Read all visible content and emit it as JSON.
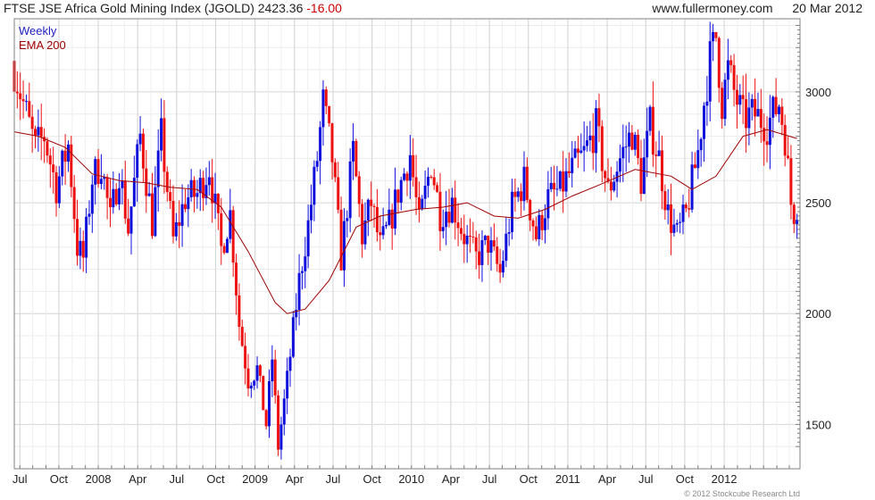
{
  "header": {
    "title": "FTSE JSE Africa Gold Mining Index (JGOLD)",
    "last": "2423.36",
    "change": "-16.00",
    "source": "www.fullermoney.com",
    "date": "20 Mar 2012"
  },
  "copyright": "© 2012 Stockcube Research Ltd",
  "colors": {
    "up": "#1010dd",
    "down": "#ee1111",
    "ema": "#a00000",
    "grid": "#d4d4d4",
    "frame": "#808080",
    "legend_weekly": "#2020c0",
    "legend_ema": "#a00000"
  },
  "chart_data": {
    "type": "candlestick",
    "legend": [
      "Weekly",
      "EMA 200"
    ],
    "x_tick_labels": [
      "Jul",
      "Oct",
      "2008",
      "Apr",
      "Jul",
      "Oct",
      "2009",
      "Apr",
      "Jul",
      "Oct",
      "2010",
      "Apr",
      "Jul",
      "Oct",
      "2011",
      "Apr",
      "Jul",
      "Oct",
      "2012"
    ],
    "y_ticks": [
      1500,
      2000,
      2500,
      3000
    ],
    "ylim": [
      1300,
      3330
    ],
    "xlim": [
      "2007-03-19",
      "2012-03-26"
    ],
    "grid": true,
    "legend_position": "top-left",
    "y_axis_side": "right",
    "close_points": [
      [
        "2007-03-19",
        3100
      ],
      [
        "2007-04-09",
        2950
      ],
      [
        "2007-05-07",
        2750
      ],
      [
        "2007-05-28",
        2800
      ],
      [
        "2007-06-25",
        2570
      ],
      [
        "2007-07-23",
        2760
      ],
      [
        "2007-08-13",
        2300
      ],
      [
        "2007-08-27",
        2250
      ],
      [
        "2007-09-17",
        2610
      ],
      [
        "2007-10-08",
        2680
      ],
      [
        "2007-10-29",
        2420
      ],
      [
        "2007-11-19",
        2650
      ],
      [
        "2007-12-10",
        2380
      ],
      [
        "2008-01-07",
        2800
      ],
      [
        "2008-02-04",
        2410
      ],
      [
        "2008-02-25",
        2800
      ],
      [
        "2008-03-24",
        2330
      ],
      [
        "2008-04-21",
        2520
      ],
      [
        "2008-05-19",
        2540
      ],
      [
        "2008-06-16",
        2660
      ],
      [
        "2008-07-14",
        2290
      ],
      [
        "2008-08-04",
        2450
      ],
      [
        "2008-08-25",
        1950
      ],
      [
        "2008-09-15",
        1700
      ],
      [
        "2008-10-06",
        1750
      ],
      [
        "2008-10-27",
        1500
      ],
      [
        "2008-11-10",
        1800
      ],
      [
        "2008-11-24",
        1400
      ],
      [
        "2008-12-15",
        1700
      ],
      [
        "2009-01-12",
        2150
      ],
      [
        "2009-02-02",
        2400
      ],
      [
        "2009-02-23",
        2700
      ],
      [
        "2009-03-09",
        2950
      ],
      [
        "2009-03-30",
        2700
      ],
      [
        "2009-04-20",
        2250
      ],
      [
        "2009-05-18",
        2730
      ],
      [
        "2009-06-08",
        2350
      ],
      [
        "2009-06-29",
        2500
      ],
      [
        "2009-07-20",
        2300
      ],
      [
        "2009-08-10",
        2400
      ],
      [
        "2009-08-31",
        2550
      ],
      [
        "2009-09-28",
        2720
      ],
      [
        "2009-10-19",
        2400
      ],
      [
        "2009-11-16",
        2680
      ],
      [
        "2009-12-07",
        2450
      ],
      [
        "2010-01-04",
        2500
      ],
      [
        "2010-02-01",
        2350
      ],
      [
        "2010-03-01",
        2250
      ],
      [
        "2010-03-29",
        2320
      ],
      [
        "2010-04-26",
        2180
      ],
      [
        "2010-05-24",
        2480
      ],
      [
        "2010-06-21",
        2600
      ],
      [
        "2010-07-19",
        2350
      ],
      [
        "2010-08-16",
        2520
      ],
      [
        "2010-09-13",
        2560
      ],
      [
        "2010-10-11",
        2650
      ],
      [
        "2010-11-08",
        2720
      ],
      [
        "2010-12-06",
        2840
      ],
      [
        "2011-01-03",
        2550
      ],
      [
        "2011-01-31",
        2700
      ],
      [
        "2011-02-28",
        2820
      ],
      [
        "2011-03-21",
        2600
      ],
      [
        "2011-04-11",
        2850
      ],
      [
        "2011-05-02",
        2700
      ],
      [
        "2011-05-23",
        2450
      ],
      [
        "2011-06-13",
        2350
      ],
      [
        "2011-07-04",
        2450
      ],
      [
        "2011-08-01",
        2730
      ],
      [
        "2011-08-15",
        2950
      ],
      [
        "2011-08-29",
        3150
      ],
      [
        "2011-09-12",
        3250
      ],
      [
        "2011-09-26",
        2950
      ],
      [
        "2011-10-10",
        3100
      ],
      [
        "2011-10-24",
        3000
      ],
      [
        "2011-11-14",
        2880
      ],
      [
        "2011-12-12",
        2900
      ],
      [
        "2012-01-09",
        2850
      ],
      [
        "2012-02-06",
        2950
      ],
      [
        "2012-02-20",
        2800
      ],
      [
        "2012-03-05",
        2500
      ],
      [
        "2012-03-19",
        2423
      ]
    ],
    "ema200_points": [
      [
        "2007-03-19",
        2820
      ],
      [
        "2007-05-14",
        2800
      ],
      [
        "2007-07-16",
        2750
      ],
      [
        "2007-09-17",
        2630
      ],
      [
        "2007-11-19",
        2600
      ],
      [
        "2008-01-21",
        2590
      ],
      [
        "2008-03-17",
        2570
      ],
      [
        "2008-05-19",
        2560
      ],
      [
        "2008-07-14",
        2480
      ],
      [
        "2008-09-15",
        2280
      ],
      [
        "2008-11-17",
        2050
      ],
      [
        "2008-12-15",
        2000
      ],
      [
        "2009-01-26",
        2020
      ],
      [
        "2009-03-23",
        2150
      ],
      [
        "2009-05-25",
        2390
      ],
      [
        "2009-07-20",
        2440
      ],
      [
        "2009-10-12",
        2470
      ],
      [
        "2009-12-14",
        2480
      ],
      [
        "2010-02-08",
        2500
      ],
      [
        "2010-04-12",
        2440
      ],
      [
        "2010-06-07",
        2430
      ],
      [
        "2010-08-09",
        2470
      ],
      [
        "2010-10-11",
        2530
      ],
      [
        "2010-12-13",
        2580
      ],
      [
        "2011-03-07",
        2650
      ],
      [
        "2011-05-30",
        2620
      ],
      [
        "2011-07-18",
        2560
      ],
      [
        "2011-09-12",
        2620
      ],
      [
        "2011-11-14",
        2800
      ],
      [
        "2012-01-09",
        2830
      ],
      [
        "2012-03-19",
        2790
      ]
    ]
  }
}
